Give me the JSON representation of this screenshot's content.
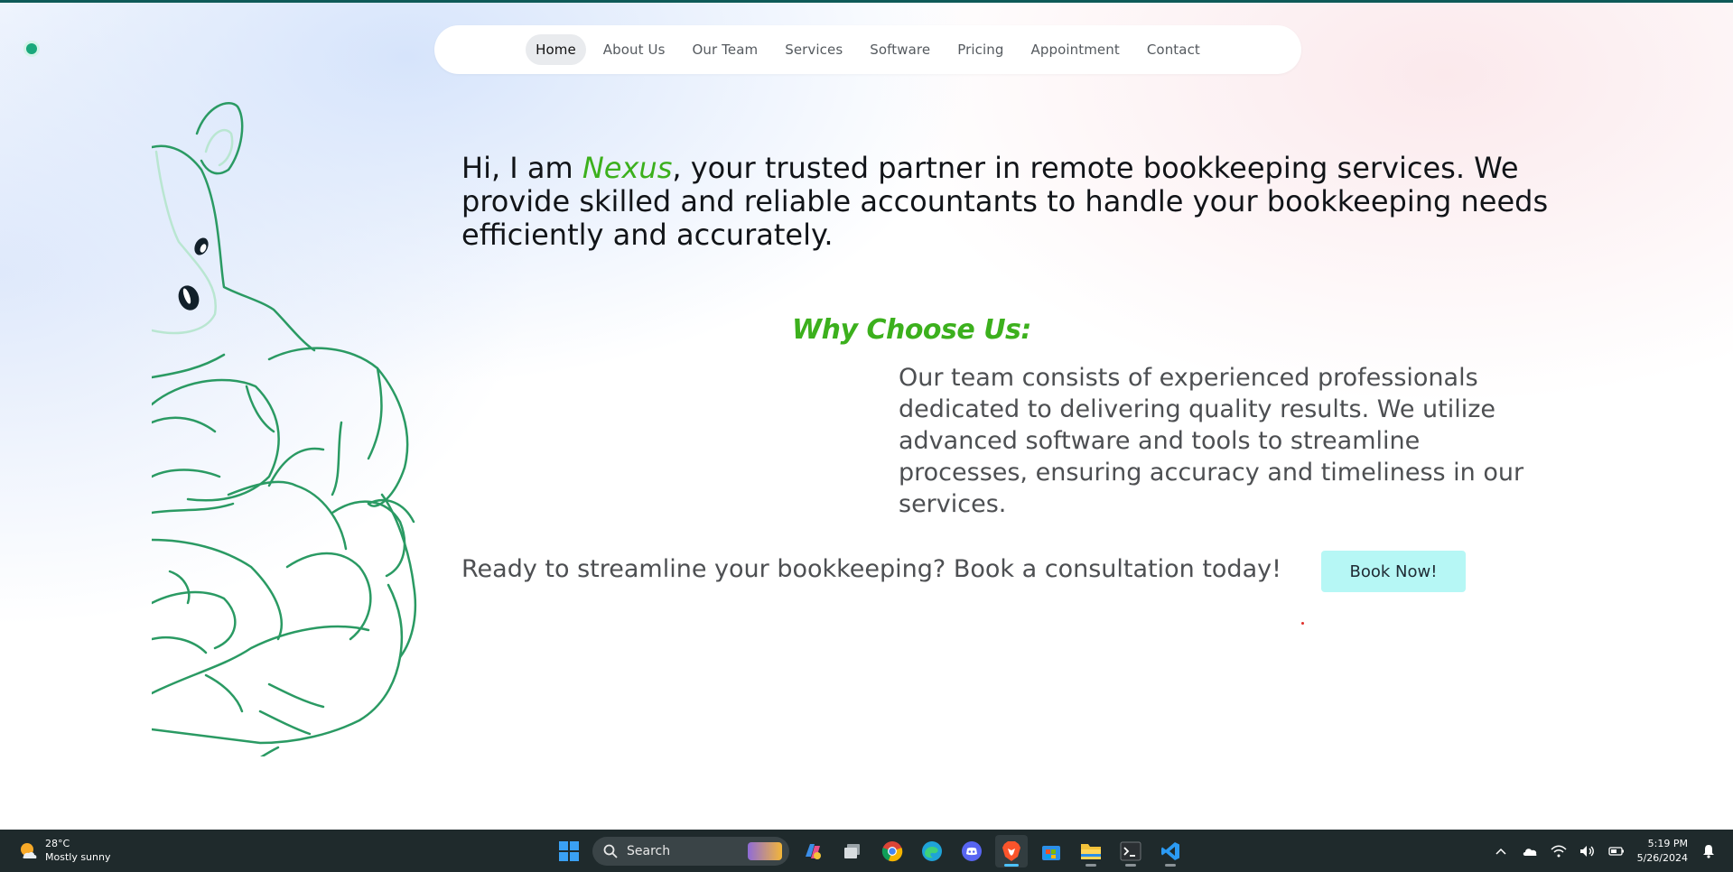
{
  "nav": {
    "items": [
      {
        "label": "Home",
        "active": true
      },
      {
        "label": "About Us"
      },
      {
        "label": "Our Team"
      },
      {
        "label": "Services"
      },
      {
        "label": "Software"
      },
      {
        "label": "Pricing"
      },
      {
        "label": "Appointment"
      },
      {
        "label": "Contact"
      }
    ]
  },
  "hero": {
    "prefix": "Hi, I am ",
    "brand": "Nexus",
    "suffix": ", your trusted partner in remote bookkeeping services. We provide skilled and reliable accountants to handle your bookkeeping needs efficiently and accurately."
  },
  "why": {
    "heading": "Why Choose Us:",
    "body": "Our team consists of experienced professionals dedicated to delivering quality results. We utilize advanced software and tools to streamline processes, ensuring accuracy and timeliness in our services."
  },
  "cta": {
    "text": "Ready to streamline your bookkeeping? Book a consultation today!",
    "button": "Book Now!"
  },
  "colors": {
    "accent_green": "#3cb01d",
    "button_bg": "#b6f7f5",
    "mascot_stroke": "#2a9a63",
    "taskbar_bg": "#1f2a2c"
  },
  "taskbar": {
    "weather": {
      "temp": "28°C",
      "condition": "Mostly sunny",
      "icon": "sun-cloud-icon"
    },
    "search_label": "Search",
    "apps": [
      "start-icon",
      "copilot-icon",
      "task-view-icon",
      "chrome-icon",
      "edge-icon",
      "discord-icon",
      "brave-icon",
      "store-icon",
      "file-explorer-icon",
      "terminal-icon",
      "vscode-icon"
    ],
    "clock": {
      "time": "5:19 PM",
      "date": "5/26/2024"
    }
  }
}
